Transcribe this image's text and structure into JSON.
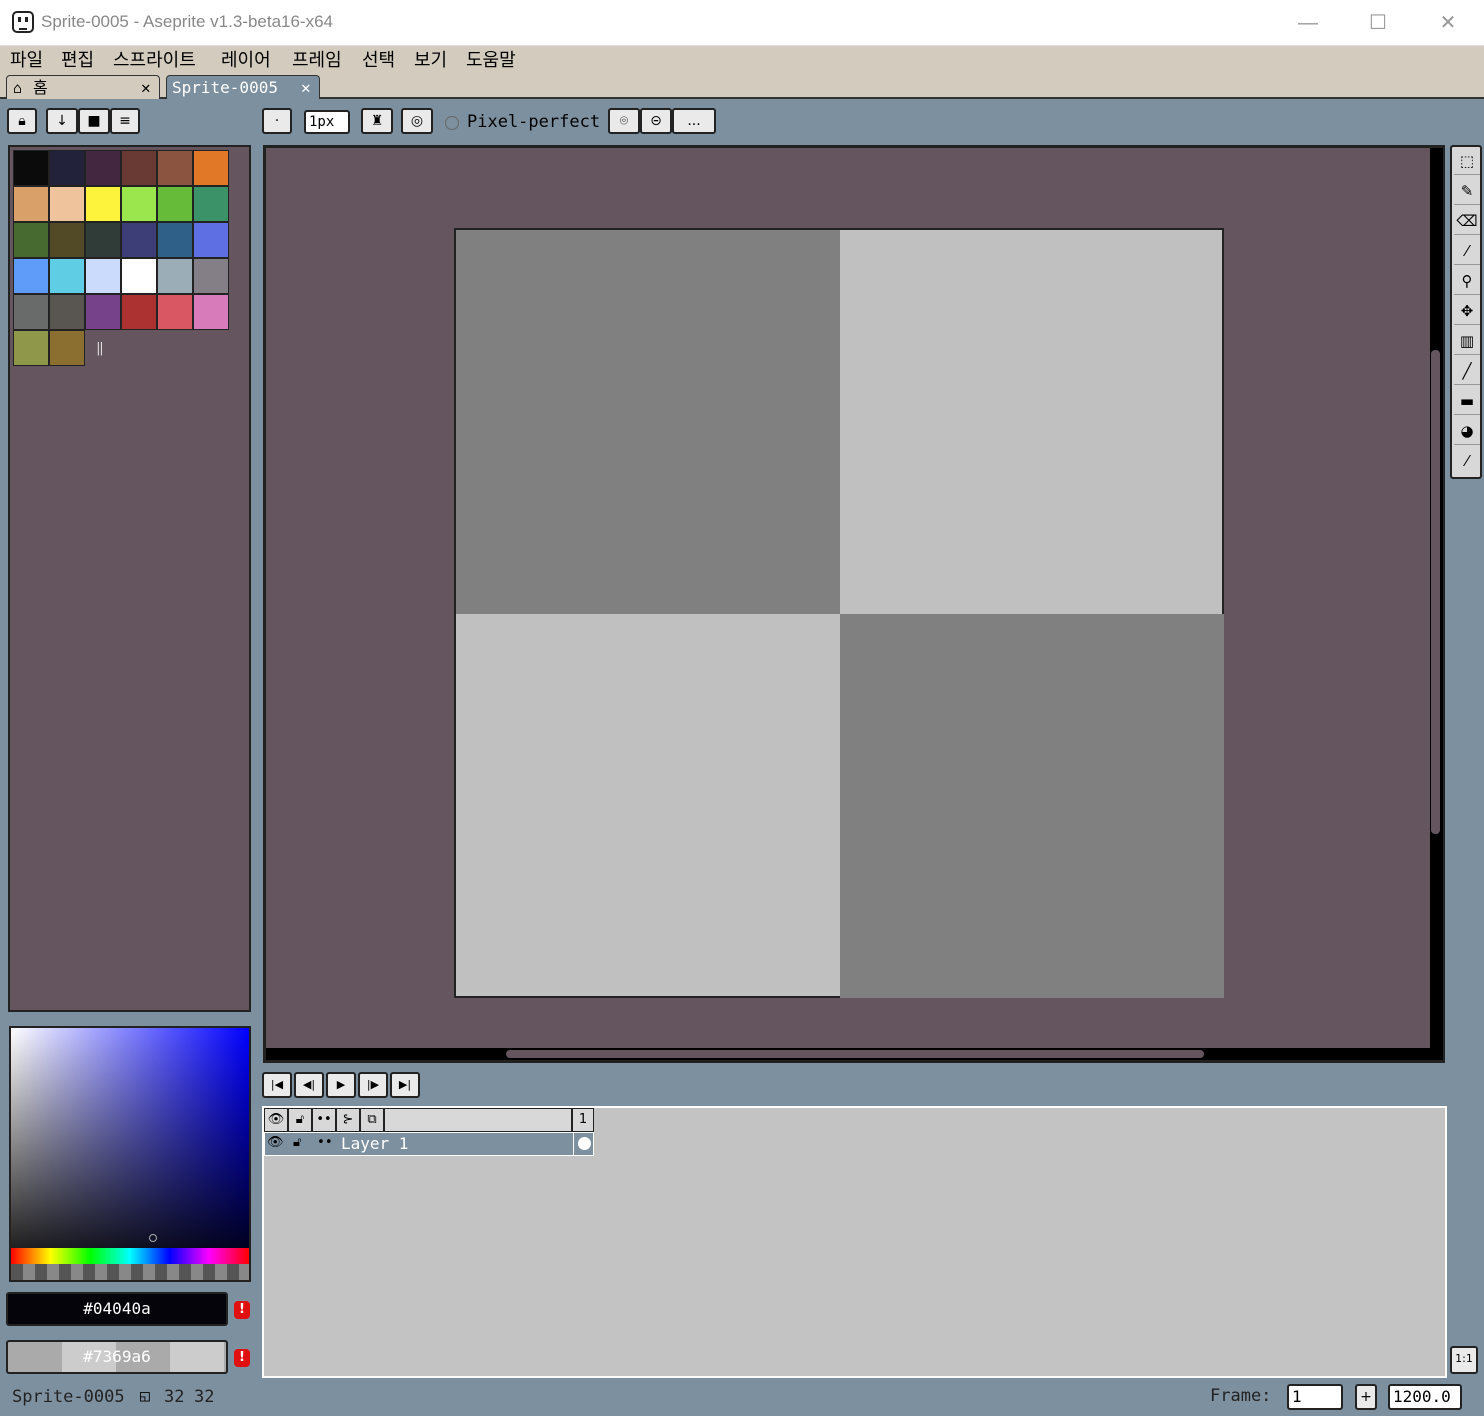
{
  "window": {
    "title": "Sprite-0005 - Aseprite v1.3-beta16-x64",
    "minimize": "—",
    "maximize": "☐",
    "close": "✕"
  },
  "menu": [
    "파일",
    "편집",
    "스프라이트",
    "레이어",
    "프레임",
    "선택",
    "보기",
    "도움말"
  ],
  "tabs": {
    "home_label": "홈",
    "home_close": "✕",
    "doc_label": "Sprite-0005",
    "doc_close": "✕"
  },
  "toolbar": {
    "brush_size": "1px",
    "pixel_perfect": "Pixel-perfect",
    "more": "..."
  },
  "palette": {
    "colors": [
      "#0b0b0b",
      "#22223a",
      "#43263f",
      "#683a33",
      "#8a5440",
      "#e07828",
      "#d9a06a",
      "#efc49c",
      "#fdf33c",
      "#9be64d",
      "#66bb38",
      "#3b9168",
      "#476a30",
      "#524a27",
      "#303c38",
      "#3d3d78",
      "#2e6088",
      "#5e6ee3",
      "#5f9bf9",
      "#5fcde4",
      "#cbdbfc",
      "#ffffff",
      "#9badb7",
      "#847e87",
      "#696a6a",
      "#595652",
      "#76428a",
      "#ac3232",
      "#d95763",
      "#d77bba",
      "#8f974a",
      "#8a6f30"
    ],
    "resize_handle": "‖"
  },
  "colors": {
    "foreground": "#04040a",
    "background": "#7369a6",
    "warn": "!"
  },
  "timeline": {
    "frame_header": "1",
    "layer_name": "Layer 1",
    "zoom_button": "1:1"
  },
  "status": {
    "sprite_name": "Sprite-0005",
    "width": "32",
    "height": "32",
    "frame_label": "Frame:",
    "frame_value": "1",
    "add": "+",
    "zoom": "1200.0"
  }
}
